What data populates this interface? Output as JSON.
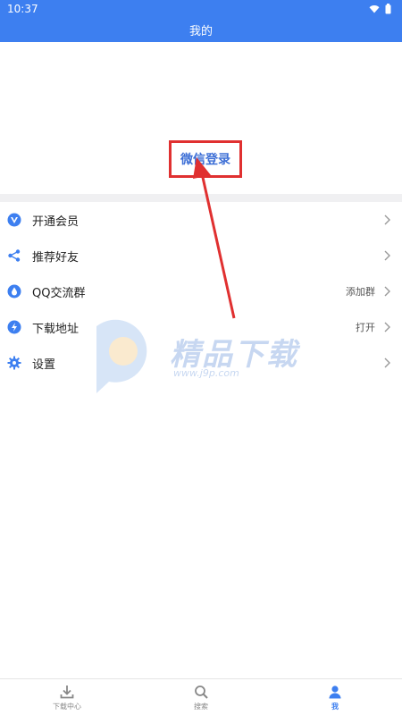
{
  "status_bar": {
    "time": "10:37"
  },
  "header": {
    "title": "我的"
  },
  "login": {
    "wechat_label": "微信登录"
  },
  "menu": [
    {
      "label": "开通会员",
      "extra": ""
    },
    {
      "label": "推荐好友",
      "extra": ""
    },
    {
      "label": "QQ交流群",
      "extra": "添加群"
    },
    {
      "label": "下载地址",
      "extra": "打开"
    },
    {
      "label": "设置",
      "extra": ""
    }
  ],
  "watermark": {
    "title": "精品下载",
    "url": "www.j9p.com"
  },
  "tabs": [
    {
      "label": "下载中心",
      "icon": "download-icon"
    },
    {
      "label": "搜索",
      "icon": "search-icon"
    },
    {
      "label": "我",
      "icon": "user-icon",
      "active": true
    }
  ],
  "colors": {
    "accent": "#3d7ff0",
    "highlight": "#e03030"
  }
}
